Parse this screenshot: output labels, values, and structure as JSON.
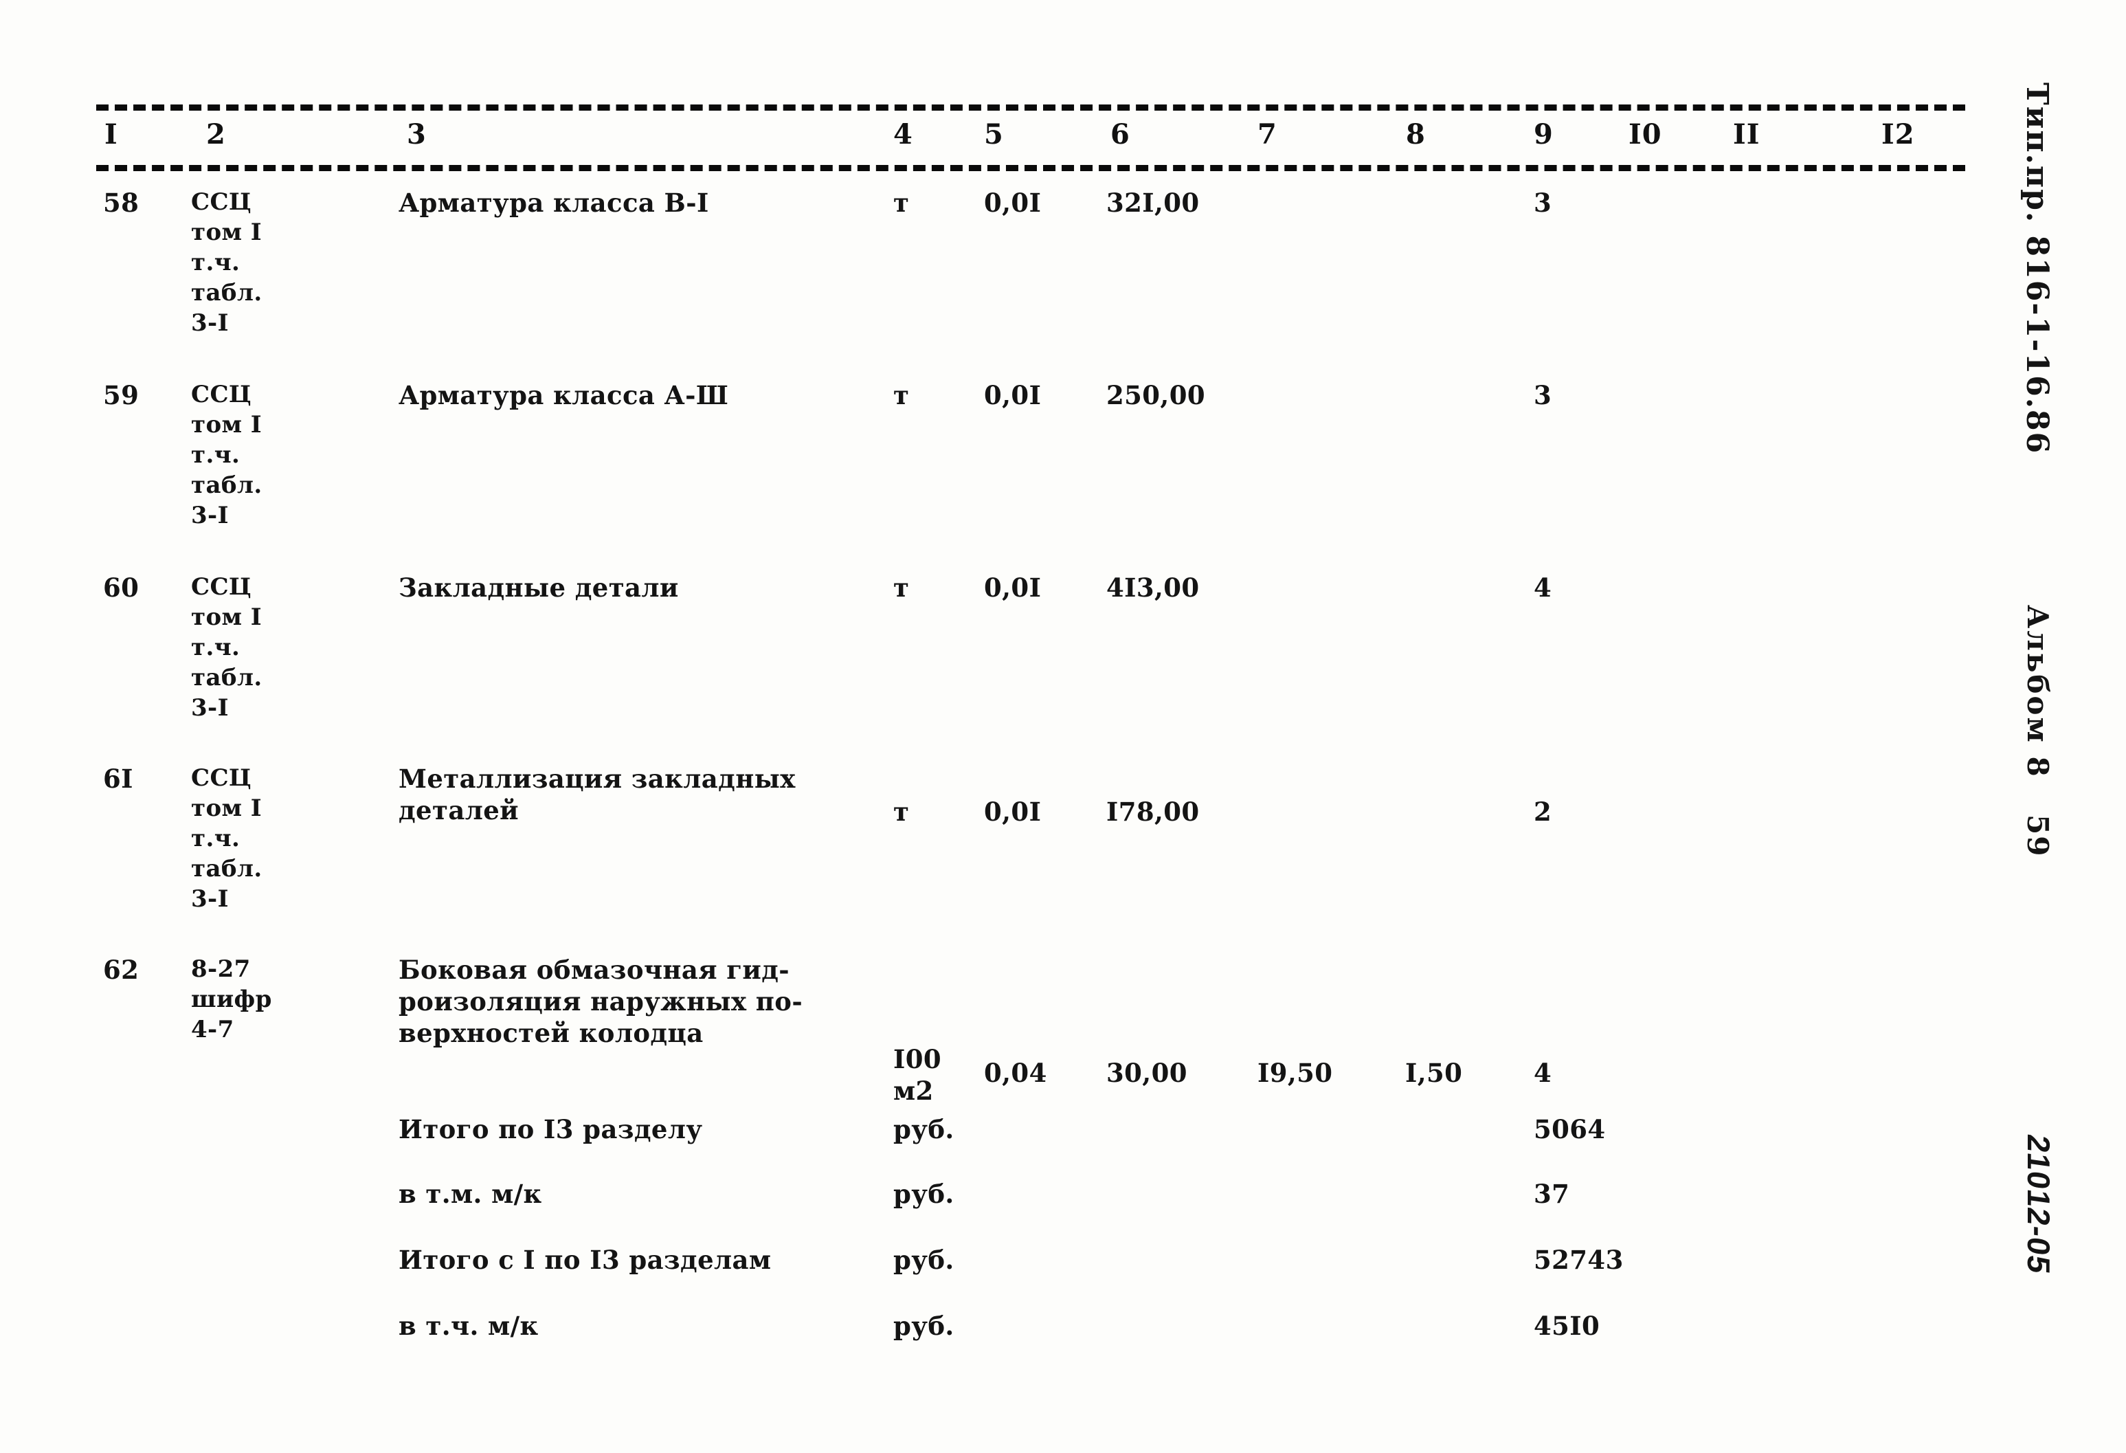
{
  "document": {
    "project_code": "Тип.пр. 816-1-16.86",
    "album_label": "Альбом 8",
    "page_number": "59",
    "doc_code": "21012-05"
  },
  "table": {
    "column_headers": [
      "I",
      "2",
      "3",
      "4",
      "5",
      "6",
      "7",
      "8",
      "9",
      "I0",
      "II",
      "I2"
    ],
    "rows": [
      {
        "num": "58",
        "ref": "ССЦ\nтом I\nт.ч.\nтабл.\n3-I",
        "desc": "Арматура класса В-I",
        "unit": "т",
        "q5": "0,0I",
        "q6": "32I,00",
        "q7": "",
        "q8": "",
        "q9": "3"
      },
      {
        "num": "59",
        "ref": "ССЦ\nтом I\nт.ч.\nтабл.\n3-I",
        "desc": "Арматура класса А-Ш",
        "unit": "т",
        "q5": "0,0I",
        "q6": "250,00",
        "q7": "",
        "q8": "",
        "q9": "3"
      },
      {
        "num": "60",
        "ref": "ССЦ\nтом I\nт.ч.\nтабл.\n3-I",
        "desc": "Закладные детали",
        "unit": "т",
        "q5": "0,0I",
        "q6": "4I3,00",
        "q7": "",
        "q8": "",
        "q9": "4"
      },
      {
        "num": "6I",
        "ref": "ССЦ\nтом I\nт.ч.\nтабл.\n3-I",
        "desc": "Металлизация закладных\nдеталей",
        "unit": "т",
        "q5": "0,0I",
        "q6": "I78,00",
        "q7": "",
        "q8": "",
        "q9": "2"
      },
      {
        "num": "62",
        "ref": "8-27\nшифр\n4-7",
        "desc": "Боковая обмазочная гид-\nроизоляция наружных по-\nверхностей колодца",
        "unit": "I00\nм2",
        "q5": "0,04",
        "q6": "30,00",
        "q7": "I9,50",
        "q8": "I,50",
        "q9": "4"
      }
    ],
    "totals": [
      {
        "label": "Итого по I3 разделу",
        "unit": "руб.",
        "value": "5064"
      },
      {
        "label": "в т.м. м/к",
        "unit": "руб.",
        "value": "37"
      },
      {
        "label": "Итого с I по I3 разделам",
        "unit": "руб.",
        "value": "52743"
      },
      {
        "label": "в т.ч. м/к",
        "unit": "руб.",
        "value": "45I0"
      }
    ]
  }
}
